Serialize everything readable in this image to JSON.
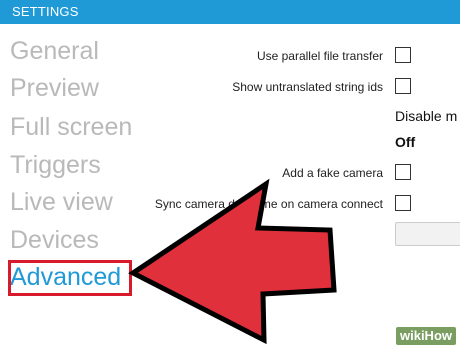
{
  "window": {
    "title": "SETTINGS"
  },
  "sidebar": {
    "items": [
      {
        "label": "General"
      },
      {
        "label": "Preview"
      },
      {
        "label": "Full screen"
      },
      {
        "label": "Triggers"
      },
      {
        "label": "Live view"
      },
      {
        "label": "Devices"
      },
      {
        "label": "Advanced"
      }
    ],
    "active": "Advanced"
  },
  "settings": {
    "parallel_transfer_label": "Use parallel file transfer",
    "untranslated_ids_label": "Show untranslated string ids",
    "disable_label": "Disable m",
    "off_label": "Off",
    "fake_camera_label": "Add a fake camera",
    "sync_time_label": "Sync camera date/time on camera connect"
  },
  "watermark": {
    "text": "wikiHow"
  },
  "colors": {
    "accent": "#1f9ad6",
    "highlight_red": "#d81b2c",
    "sidebar_inactive": "#b9b9b9"
  }
}
